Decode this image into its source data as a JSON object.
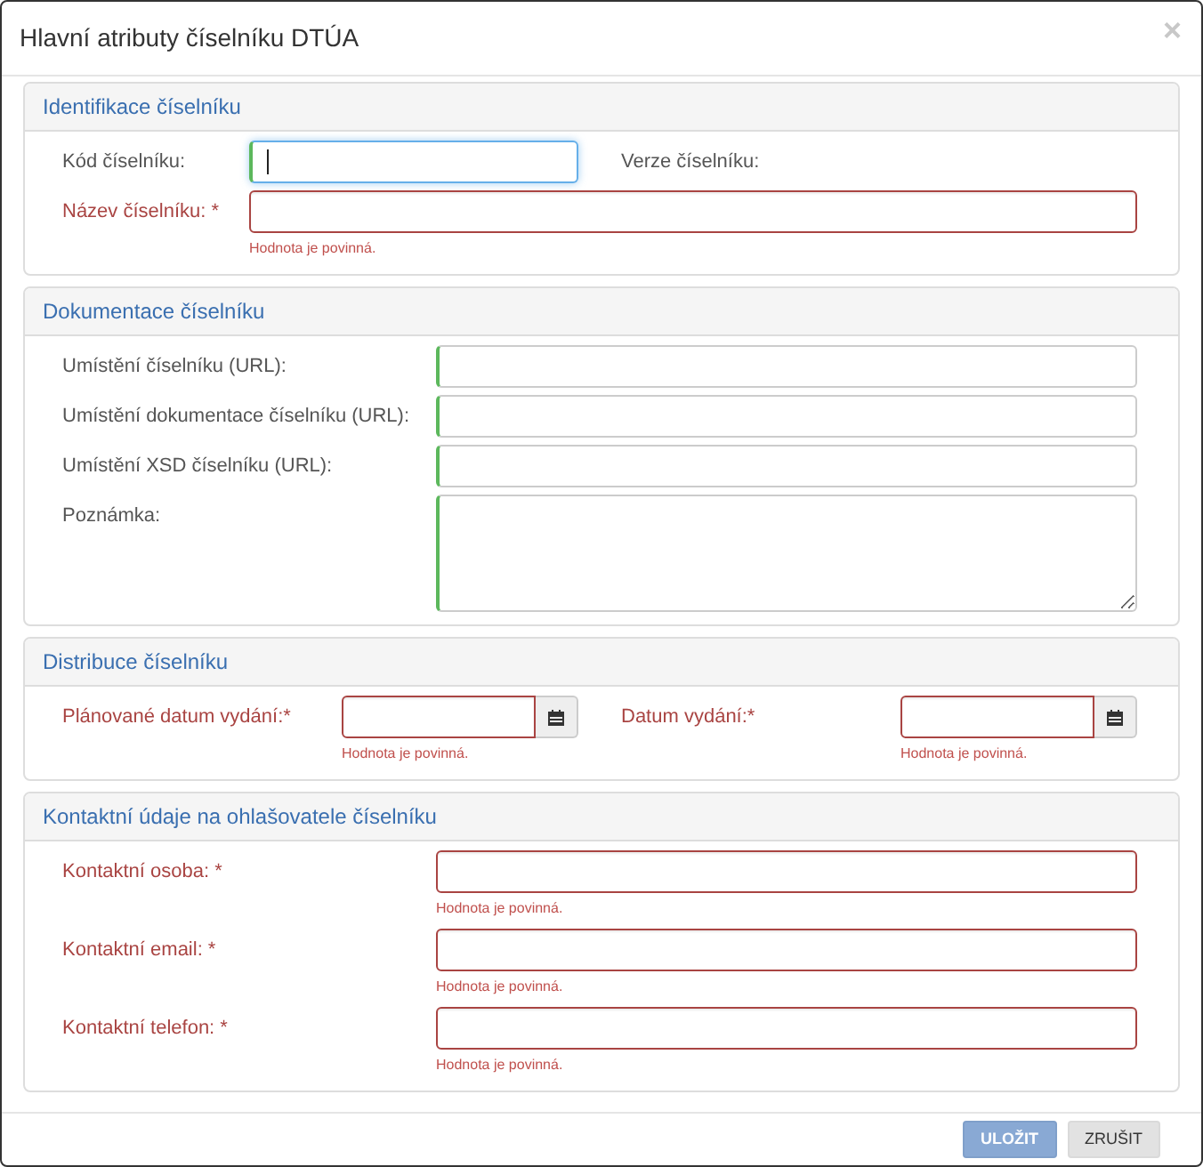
{
  "dialog": {
    "title": "Hlavní atributy číselníku DTÚA",
    "close_button": "×"
  },
  "sections": [
    {
      "title": "Identifikace číselníku",
      "rows": [
        {
          "fields": [
            {
              "label": "Kód číselníku:",
              "kind": "text",
              "valid": true,
              "invalid": false,
              "focused": true
            },
            {
              "label": "Verze číselníku:",
              "kind": "static"
            }
          ]
        },
        {
          "fields": [
            {
              "label": "Název číselníku: *",
              "kind": "text",
              "valid": false,
              "invalid": true,
              "focused": false,
              "message": "Hodnota je povinná."
            }
          ]
        }
      ]
    },
    {
      "title": "Dokumentace číselníku",
      "rows": [
        {
          "fields": [
            {
              "label": "Umístění číselníku (URL):",
              "kind": "text",
              "valid": true,
              "invalid": false,
              "focused": false
            }
          ]
        },
        {
          "fields": [
            {
              "label": "Umístění dokumentace číselníku (URL):",
              "kind": "text",
              "valid": true,
              "invalid": false,
              "focused": false
            }
          ]
        },
        {
          "fields": [
            {
              "label": "Umístění XSD číselníku (URL):",
              "kind": "text",
              "valid": true,
              "invalid": false,
              "focused": false
            }
          ]
        },
        {
          "fields": [
            {
              "label": "Poznámka:",
              "kind": "textarea",
              "valid": true,
              "invalid": false,
              "focused": false
            }
          ]
        }
      ]
    },
    {
      "title": "Distribuce číselníku",
      "rows": [
        {
          "fields": [
            {
              "label": "Plánované datum vydání:*",
              "kind": "date",
              "valid": false,
              "invalid": true,
              "focused": false,
              "message": "Hodnota je povinná."
            },
            {
              "label": "Datum vydání:*",
              "kind": "date",
              "valid": false,
              "invalid": true,
              "focused": false,
              "message": "Hodnota je povinná."
            }
          ]
        }
      ]
    },
    {
      "title": "Kontaktní údaje na ohlašovatele číselníku",
      "rows": [
        {
          "fields": [
            {
              "label": "Kontaktní osoba: *",
              "kind": "text",
              "valid": false,
              "invalid": true,
              "focused": false,
              "message": "Hodnota je povinná."
            }
          ]
        },
        {
          "fields": [
            {
              "label": "Kontaktní email: *",
              "kind": "text",
              "valid": false,
              "invalid": true,
              "focused": false,
              "message": "Hodnota je povinná."
            }
          ]
        },
        {
          "fields": [
            {
              "label": "Kontaktní telefon: *",
              "kind": "text",
              "valid": false,
              "invalid": true,
              "focused": false,
              "message": "Hodnota je povinná."
            }
          ]
        }
      ]
    }
  ],
  "buttons": [
    {
      "label": "ULOŽIT",
      "kind": "primary",
      "disabled": true
    },
    {
      "label": "ZRUŠIT",
      "kind": "default",
      "disabled": false
    }
  ]
}
